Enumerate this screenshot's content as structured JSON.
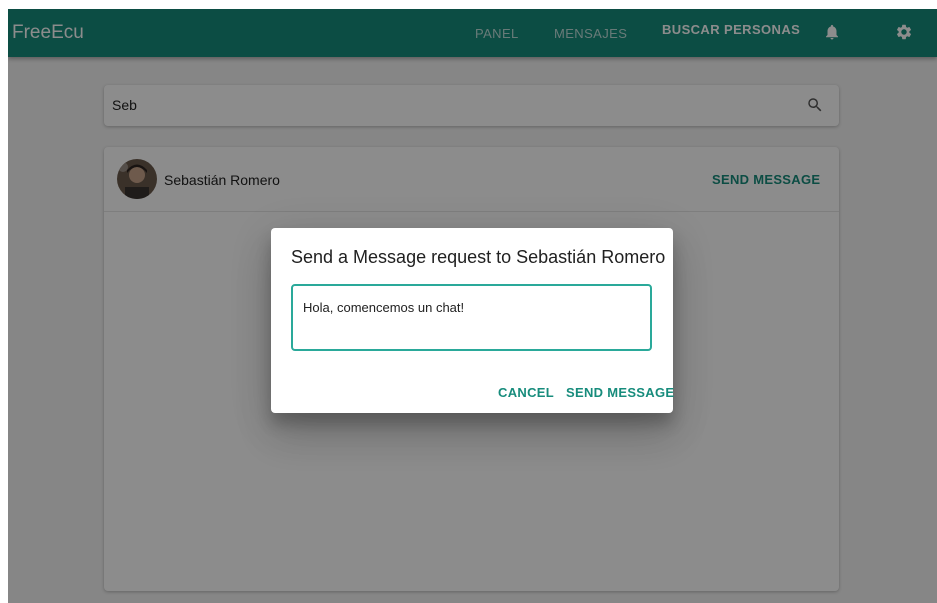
{
  "app": {
    "brand": "FreeEcu",
    "colors": {
      "primary": "#178c7c",
      "accent": "#2aa99a"
    }
  },
  "nav": {
    "items": [
      {
        "label": "PANEL",
        "active": false
      },
      {
        "label": "MENSAJES",
        "active": false
      },
      {
        "label": "BUSCAR PERSONAS",
        "active": true
      }
    ],
    "icons": [
      "bell-icon",
      "gear-icon"
    ]
  },
  "search": {
    "value": "Seb",
    "icon": "search-icon"
  },
  "results": [
    {
      "name": "Sebastián Romero",
      "action_label": "SEND MESSAGE"
    }
  ],
  "dialog": {
    "title": "Send a Message request to Sebastián Romero",
    "message_value": "Hola, comencemos un chat!",
    "cancel_label": "CANCEL",
    "send_label": "SEND MESSAGE"
  }
}
